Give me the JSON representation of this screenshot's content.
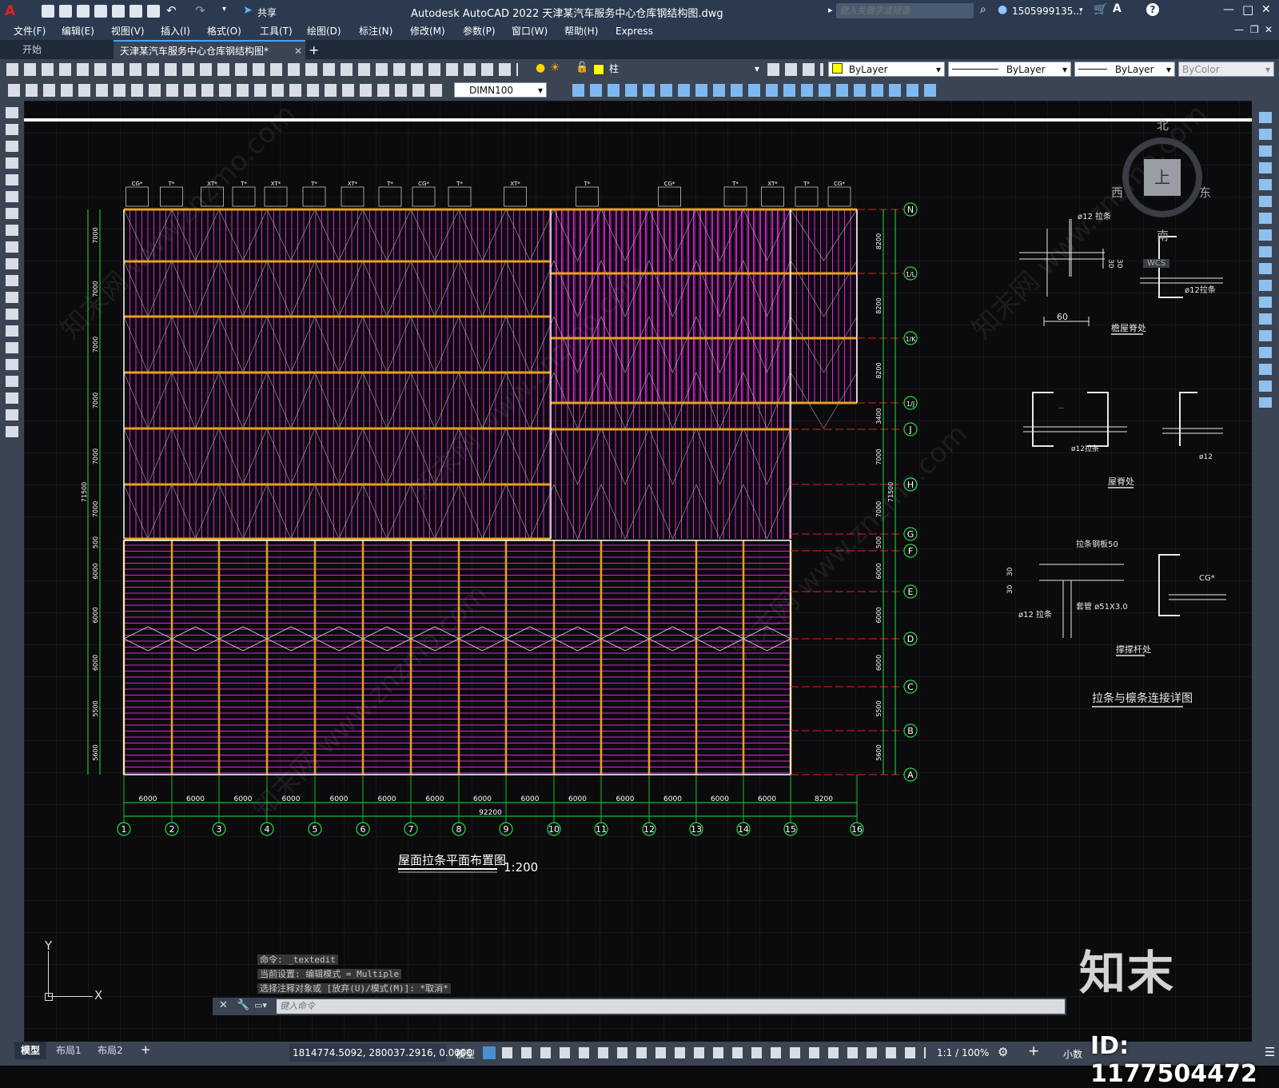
{
  "app": {
    "title": "Autodesk AutoCAD 2022    天津某汽车服务中心仓库钢结构图.dwg",
    "share_label": "共享",
    "search_placeholder": "键入关键字或短语",
    "user": "1505999135...",
    "window_controls": {
      "minimize": "—",
      "maximize": "□",
      "close": "✕"
    }
  },
  "menus": [
    "文件(F)",
    "编辑(E)",
    "视图(V)",
    "插入(I)",
    "格式(O)",
    "工具(T)",
    "绘图(D)",
    "标注(N)",
    "修改(M)",
    "参数(P)",
    "窗口(W)",
    "帮助(H)",
    "Express"
  ],
  "tabs": [
    {
      "label": "开始",
      "active": false
    },
    {
      "label": "天津某汽车服务中心仓库钢结构图*",
      "active": true
    }
  ],
  "tab_add": "+",
  "toolbar": {
    "layer_name": "柱",
    "color": "ByLayer",
    "linetype": "ByLayer",
    "lineweight": "ByLayer",
    "plotstyle": "ByColor",
    "dimstyle": "DIMN100"
  },
  "viewcube": {
    "north": "北",
    "south": "南",
    "east": "东",
    "west": "西",
    "top": "上",
    "wcs": "WCS"
  },
  "drawing": {
    "plan_title": "屋面拉条平面布置图",
    "plan_scale": "1:200",
    "total_width_label": "92200",
    "total_height_label": "71500",
    "col_labels": [
      "1",
      "2",
      "3",
      "4",
      "5",
      "6",
      "7",
      "8",
      "9",
      "10",
      "11",
      "12",
      "13",
      "14",
      "15",
      "16"
    ],
    "col_spacings": [
      "6000",
      "6000",
      "6000",
      "6000",
      "6000",
      "6000",
      "6000",
      "6000",
      "6000",
      "6000",
      "6000",
      "6000",
      "6000",
      "6000",
      "8200"
    ],
    "row_labels": [
      "N",
      "1/L",
      "1/K",
      "1/J",
      "J",
      "H",
      "G",
      "F",
      "E",
      "D",
      "C",
      "B",
      "A"
    ],
    "left_dims": [
      "7000",
      "7000",
      "7000",
      "7000",
      "7000",
      "7000",
      "500",
      "6000",
      "6000",
      "6000",
      "5500",
      "5600"
    ],
    "right_dims": [
      "8200",
      "8200",
      "8200",
      "3400",
      "7000",
      "7000",
      "500",
      "6000",
      "6000",
      "6000",
      "5500",
      "5600"
    ],
    "top_tags": [
      "CG*",
      "T*",
      "XT*",
      "T*",
      "XT*",
      "T*",
      "XT*",
      "T*",
      "CG*",
      "T*",
      "XT*",
      "T*",
      "CG*",
      "T*",
      "XT*",
      "T*",
      "CG*"
    ],
    "detail_title": "拉条与檩条连接详图",
    "detail_labels": [
      "ø12 拉条",
      "60",
      "30",
      "30",
      "屋屋脊处",
      "屋脊处",
      "ø12拉条",
      "ø12 拉条",
      "ø12",
      "拉条钢板50",
      "30",
      "30",
      "套管 ø51X3.0",
      "ø12 拉条",
      "CG*",
      "撑撑杆处",
      "ø12拉条"
    ],
    "detail_tag_roof": "檐屋脊处",
    "detail_tag_ridge": "屋脊处",
    "detail_tag_brace": "撑撑杆处",
    "watermark": "知末网 www.znzmo.com"
  },
  "command": {
    "history": [
      "命令: _textedit",
      "当前设置: 编辑模式 = Multiple",
      "选择注释对象或 [放弃(U)/模式(M)]: *取消*"
    ],
    "placeholder": "键入命令"
  },
  "ucs": {
    "x": "X",
    "y": "Y"
  },
  "layout_tabs": [
    "模型",
    "布局1",
    "布局2"
  ],
  "layout_add": "+",
  "status": {
    "coords": "1814774.5092, 280037.2916, 0.0000",
    "model": "模型",
    "scale": "1:1 / 100%",
    "units": "小数"
  },
  "brand": {
    "logo": "知末",
    "id": "ID: 1177504472"
  },
  "colors": {
    "accent": "#2b3a4f",
    "toolbar": "#3b4453",
    "magenta": "#e020e0",
    "orange": "#e8a020",
    "green": "#20e040",
    "red": "#e02020"
  }
}
